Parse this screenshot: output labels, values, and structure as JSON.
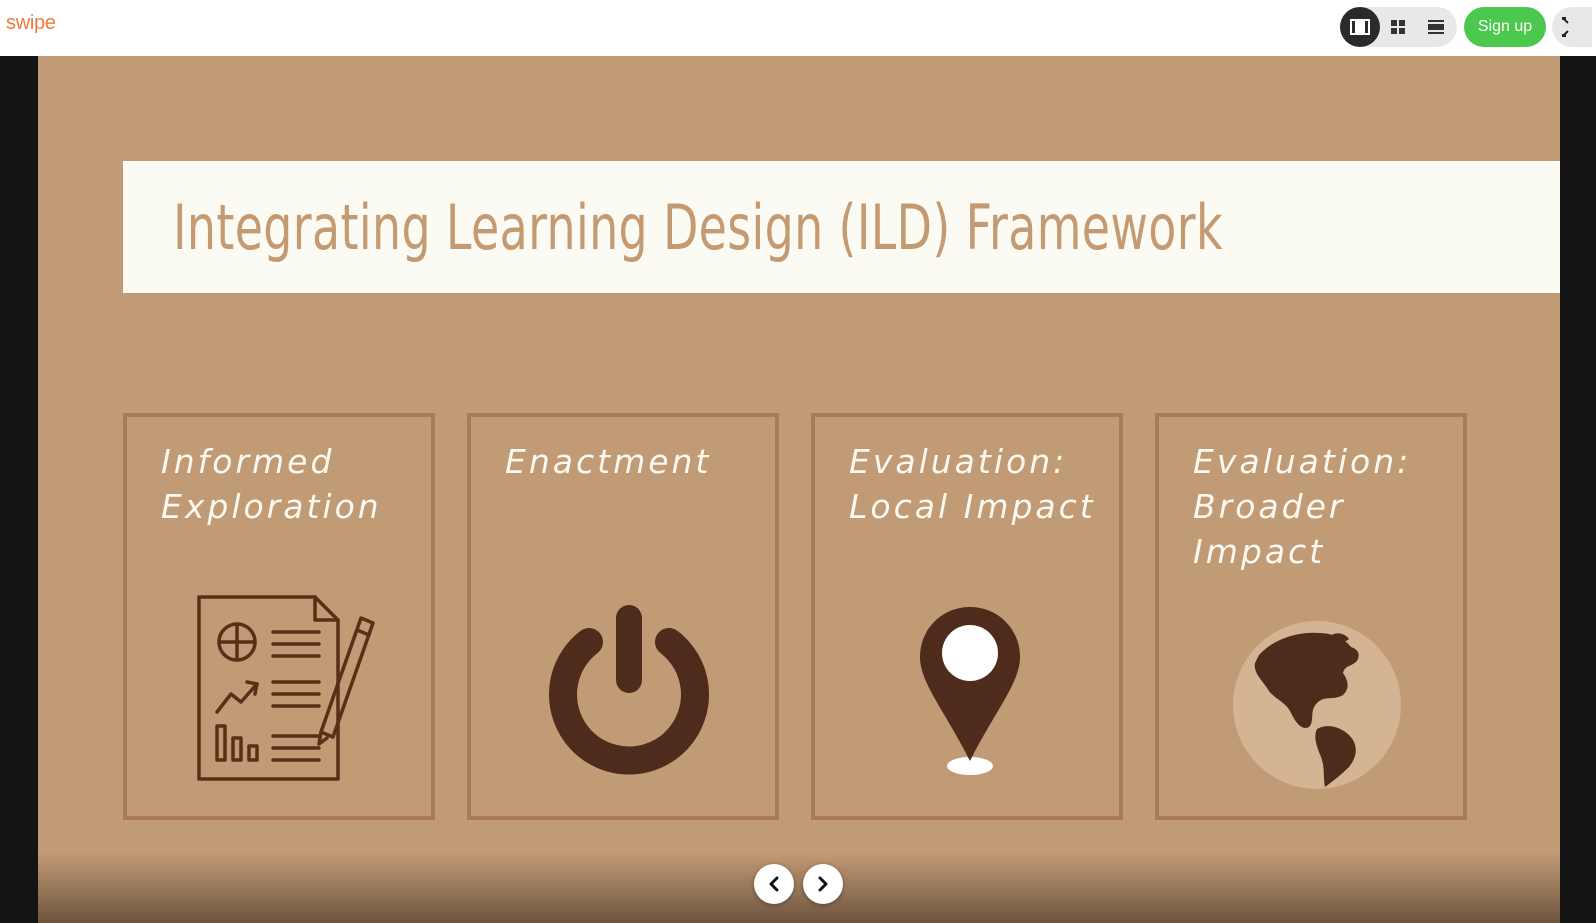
{
  "app": {
    "logo": "swipe",
    "signup_label": "Sign up"
  },
  "toolbar": {
    "view_modes": [
      {
        "icon": "single-slide-view-icon",
        "active": true
      },
      {
        "icon": "grid-view-icon",
        "active": false
      },
      {
        "icon": "scroll-view-icon",
        "active": false
      }
    ],
    "fullscreen_icon": "expand-icon"
  },
  "slide": {
    "title": "Integrating Learning Design (ILD) Framework",
    "cards": [
      {
        "title": "Informed Exploration",
        "icon": "report-document-icon"
      },
      {
        "title": "Enactment",
        "icon": "power-icon"
      },
      {
        "title": "Evaluation: Local Impact",
        "icon": "location-pin-icon"
      },
      {
        "title": "Evaluation: Broader Impact",
        "icon": "globe-icon"
      }
    ]
  },
  "navigation": {
    "prev_icon": "chevron-left-icon",
    "next_icon": "chevron-right-icon"
  },
  "colors": {
    "slide_background": "#c19b75",
    "title_band": "#fbfaf3",
    "title_text": "#c49a72",
    "card_border": "#a87a58",
    "icon_dark": "#4f2b1b",
    "signup_green": "#4cc84e",
    "logo_orange": "#ef7a3d"
  }
}
